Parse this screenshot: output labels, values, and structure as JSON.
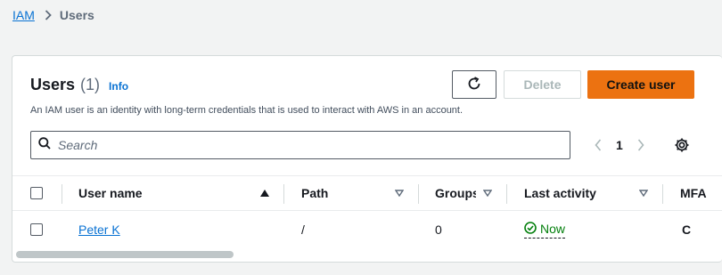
{
  "breadcrumb": {
    "root": "IAM",
    "current": "Users"
  },
  "panel": {
    "title": "Users",
    "count": "(1)",
    "info": "Info",
    "description": "An IAM user is an identity with long-term credentials that is used to interact with AWS in an account."
  },
  "toolbar": {
    "delete_label": "Delete",
    "create_label": "Create user"
  },
  "search": {
    "placeholder": "Search"
  },
  "pagination": {
    "current_page": "1"
  },
  "table": {
    "columns": [
      "User name",
      "Path",
      "Groups",
      "Last activity",
      "MFA"
    ],
    "rows": [
      {
        "user_name": "Peter K",
        "path": "/",
        "groups": "0",
        "last_activity": "Now",
        "mfa": "C"
      }
    ]
  },
  "colors": {
    "accent": "#0972d3",
    "primary_button": "#ec7211",
    "success": "#037f0c"
  }
}
